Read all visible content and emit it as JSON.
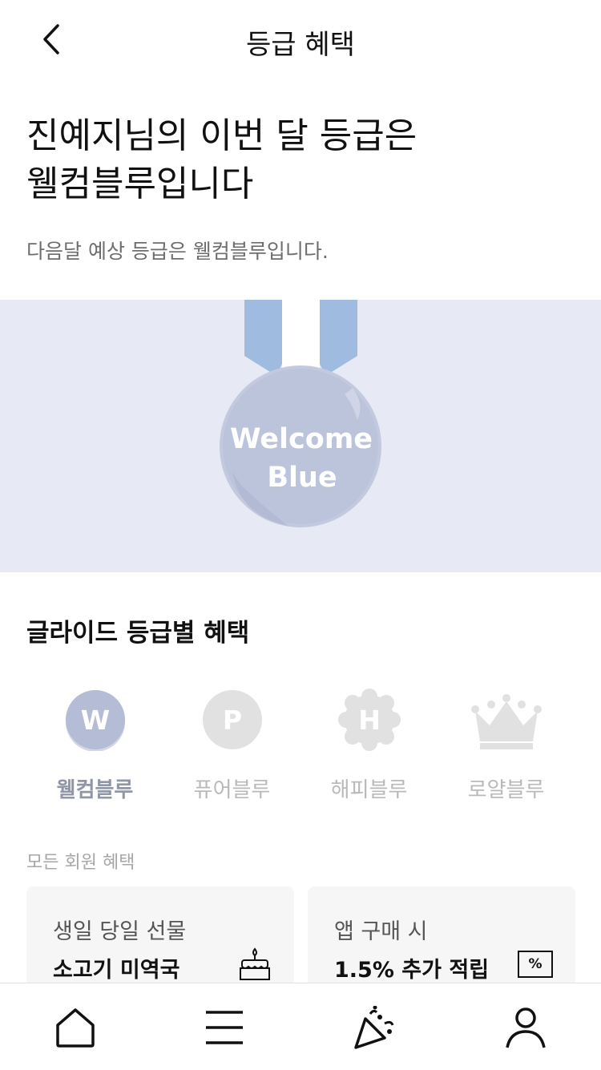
{
  "header": {
    "title": "등급 혜택"
  },
  "hero": {
    "title_line1": "진예지님의 이번 달 등급은",
    "title_line2": "웰컴블루입니다",
    "subtitle": "다음달 예상 등급은 웰컴블루입니다."
  },
  "medal": {
    "line1": "Welcome",
    "line2": "Blue",
    "ribbon_color": "#9fbbe0",
    "disc_color": "#bcc4dc"
  },
  "benefits": {
    "title": "글라이드 등급별 혜택",
    "tiers": [
      {
        "letter": "W",
        "label": "웰컴블루",
        "active": true,
        "icon": "w-circle-icon"
      },
      {
        "letter": "P",
        "label": "퓨어블루",
        "active": false,
        "icon": "p-circle-icon"
      },
      {
        "letter": "H",
        "label": "해피블루",
        "active": false,
        "icon": "h-flower-icon"
      },
      {
        "letter": "",
        "label": "로얄블루",
        "active": false,
        "icon": "crown-icon"
      }
    ],
    "all_members_label": "모든 회원 혜택",
    "cards": [
      {
        "line1": "생일 당일 선물",
        "line2": "소고기 미역국",
        "icon": "cake-icon"
      },
      {
        "line1": "앱 구매 시",
        "line2": "1.5% 추가 적립",
        "icon": "percent-icon",
        "icon_text": "%"
      }
    ]
  },
  "tabbar": {
    "items": [
      {
        "icon": "home-icon"
      },
      {
        "icon": "menu-icon"
      },
      {
        "icon": "party-popper-icon"
      },
      {
        "icon": "user-icon"
      }
    ]
  }
}
